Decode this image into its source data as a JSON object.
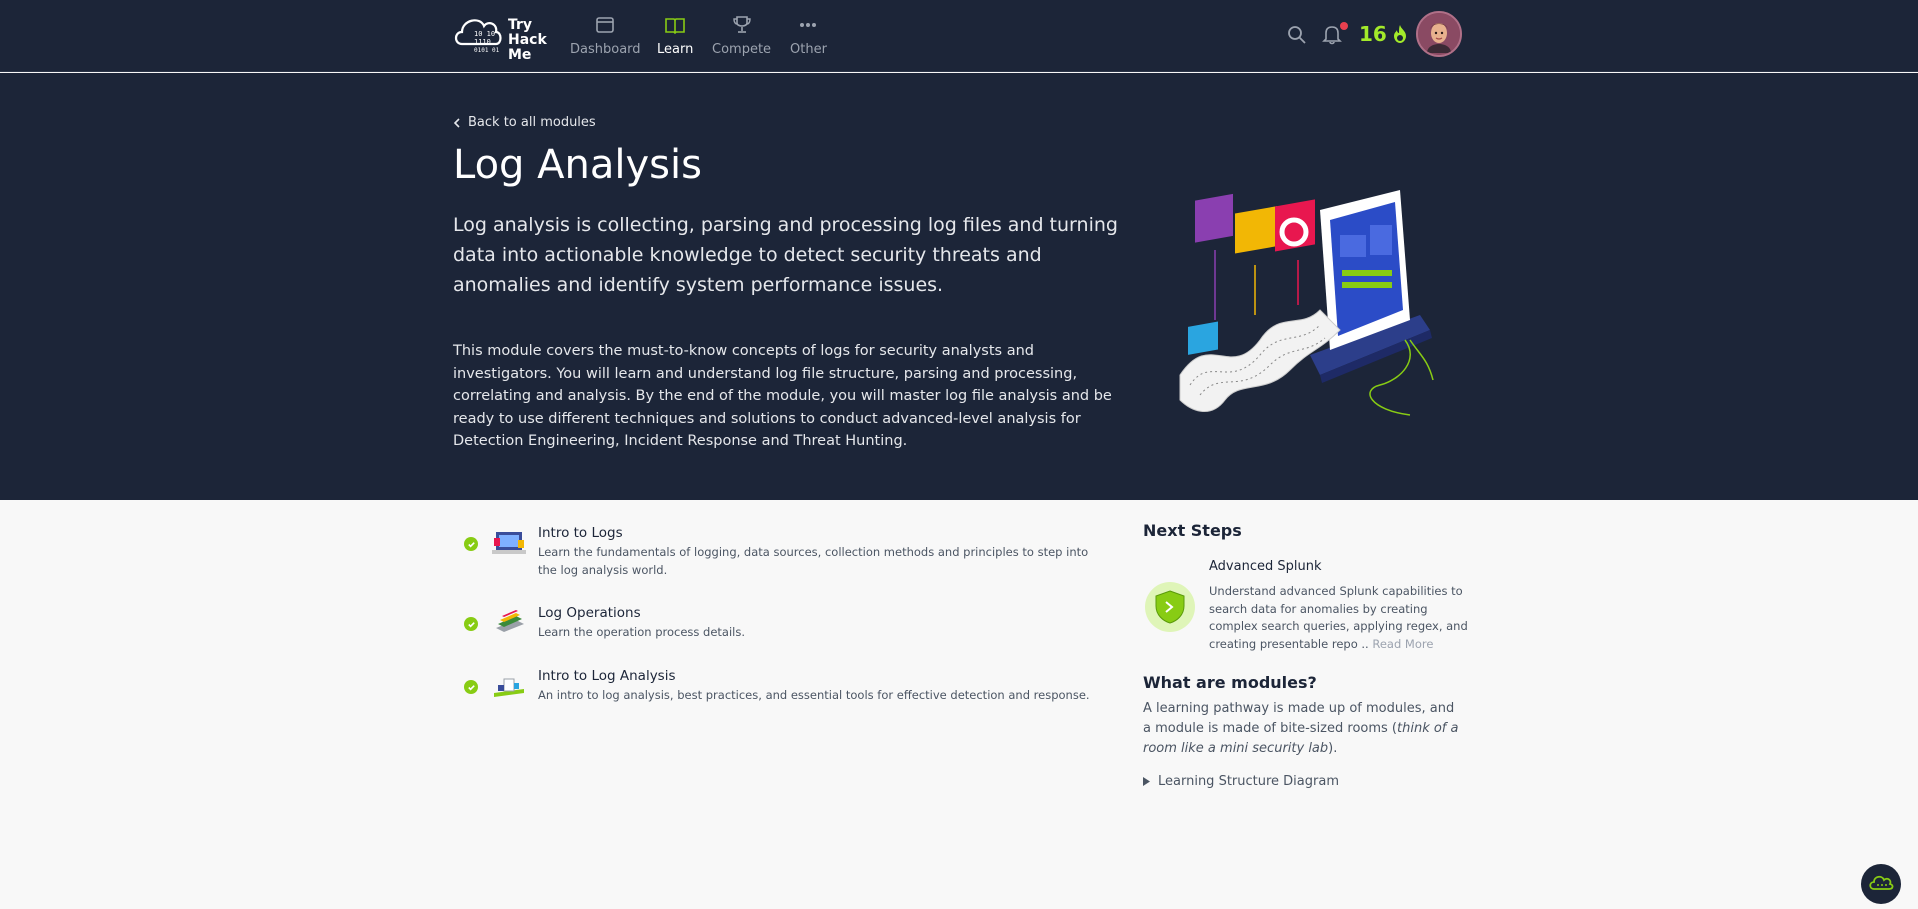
{
  "navbar": {
    "logo_text": [
      "Try",
      "Hack",
      "Me"
    ],
    "items": [
      {
        "label": "Dashboard",
        "icon": "dashboard-icon",
        "active": false
      },
      {
        "label": "Learn",
        "icon": "book-icon",
        "active": true
      },
      {
        "label": "Compete",
        "icon": "trophy-icon",
        "active": false
      },
      {
        "label": "Other",
        "icon": "dots-icon",
        "active": false
      }
    ],
    "streak": "16"
  },
  "hero": {
    "back_label": "Back to all modules",
    "title": "Log Analysis",
    "lead": "Log analysis is collecting, parsing and processing log files and turning data into actionable knowledge to detect security threats and anomalies and identify system performance issues.",
    "description": "This module covers the must-to-know concepts of logs for security analysts and investigators. You will learn and understand log file structure, parsing and processing, correlating and analysis. By the end of the module, you will master log file analysis and be ready to use different techniques and solutions to conduct advanced-level analysis for Detection Engineering, Incident Response and Threat Hunting."
  },
  "rooms": [
    {
      "title": "Intro to Logs",
      "desc": "Learn the fundamentals of logging, data sources, collection methods and principles to step into the log analysis world.",
      "completed": true
    },
    {
      "title": "Log Operations",
      "desc": "Learn the operation process details.",
      "completed": true
    },
    {
      "title": "Intro to Log Analysis",
      "desc": "An intro to log analysis, best practices, and essential tools for effective detection and response.",
      "completed": true
    }
  ],
  "sidebar": {
    "next_steps_heading": "Next Steps",
    "next_step": {
      "title": "Advanced Splunk",
      "desc": "Understand advanced Splunk capabilities to search data for anomalies by creating complex search queries, applying regex, and creating presentable repo ..",
      "read_more": "Read More"
    },
    "what_heading": "What are modules?",
    "what_text_1": "A learning pathway is made up of modules, and a module is made of bite-sized rooms (",
    "what_text_em": "think of a room like a mini security lab",
    "what_text_2": ").",
    "diagram_label": "Learning Structure Diagram"
  },
  "colors": {
    "navy": "#1c2538",
    "accent_green": "#88cc14",
    "streak_green": "#a3ea2a"
  }
}
